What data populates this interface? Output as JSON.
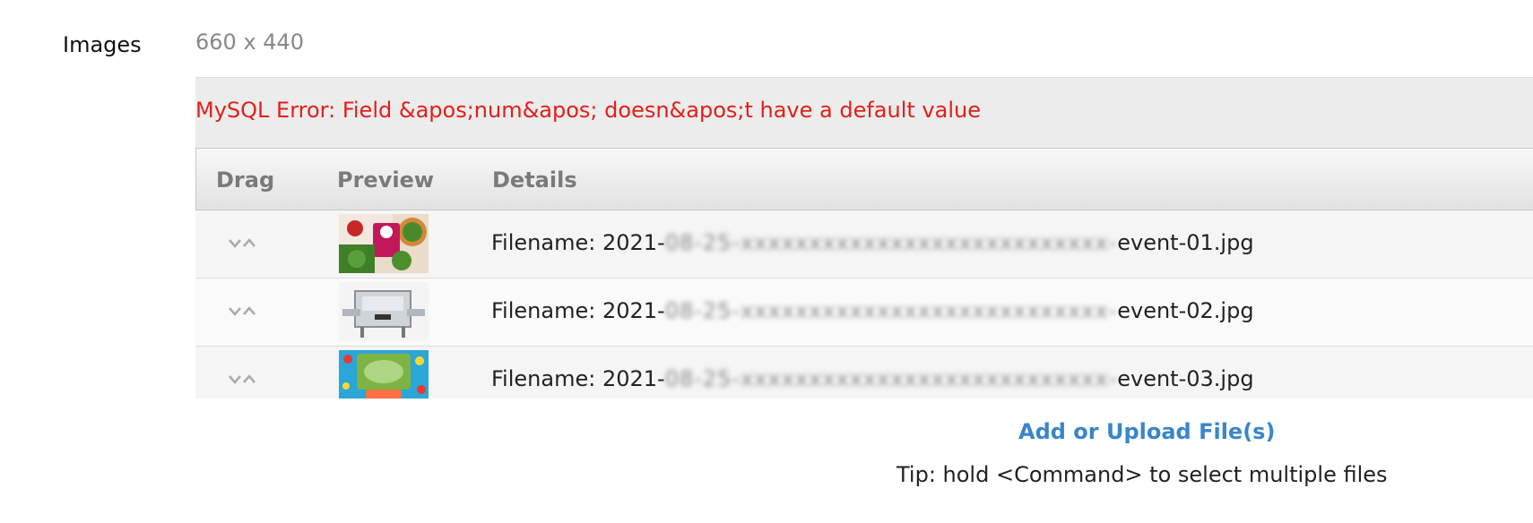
{
  "field": {
    "label": "Images",
    "dimensions": "660 x 440"
  },
  "error": {
    "message": "MySQL Error: Field &apos;num&apos; doesn&apos;t have a default value",
    "color": "#e0201a"
  },
  "table": {
    "headers": {
      "drag": "Drag",
      "preview": "Preview",
      "details": "Details"
    },
    "rows": [
      {
        "prefix": "Filename: 2021-",
        "blurred": "08-25-xxxxxxxxxxxxxxxxxxxxxxxxxxx-",
        "suffix": "event-01.jpg",
        "preview_icon": "thumbnail-salad-food"
      },
      {
        "prefix": "Filename: 2021-",
        "blurred": "08-25-xxxxxxxxxxxxxxxxxxxxxxxxxxx-",
        "suffix": "event-02.jpg",
        "preview_icon": "thumbnail-tray-machine"
      },
      {
        "prefix": "Filename: 2021-",
        "blurred": "08-25-xxxxxxxxxxxxxxxxxxxxxxxxxxx-",
        "suffix": "event-03.jpg",
        "preview_icon": "thumbnail-salad-package"
      }
    ]
  },
  "actions": {
    "upload_label": "Add or Upload File(s)",
    "tip": "Tip: hold <Command> to select multiple files"
  },
  "colors": {
    "link": "#3a86c8",
    "header_text": "#7a7a7a"
  }
}
